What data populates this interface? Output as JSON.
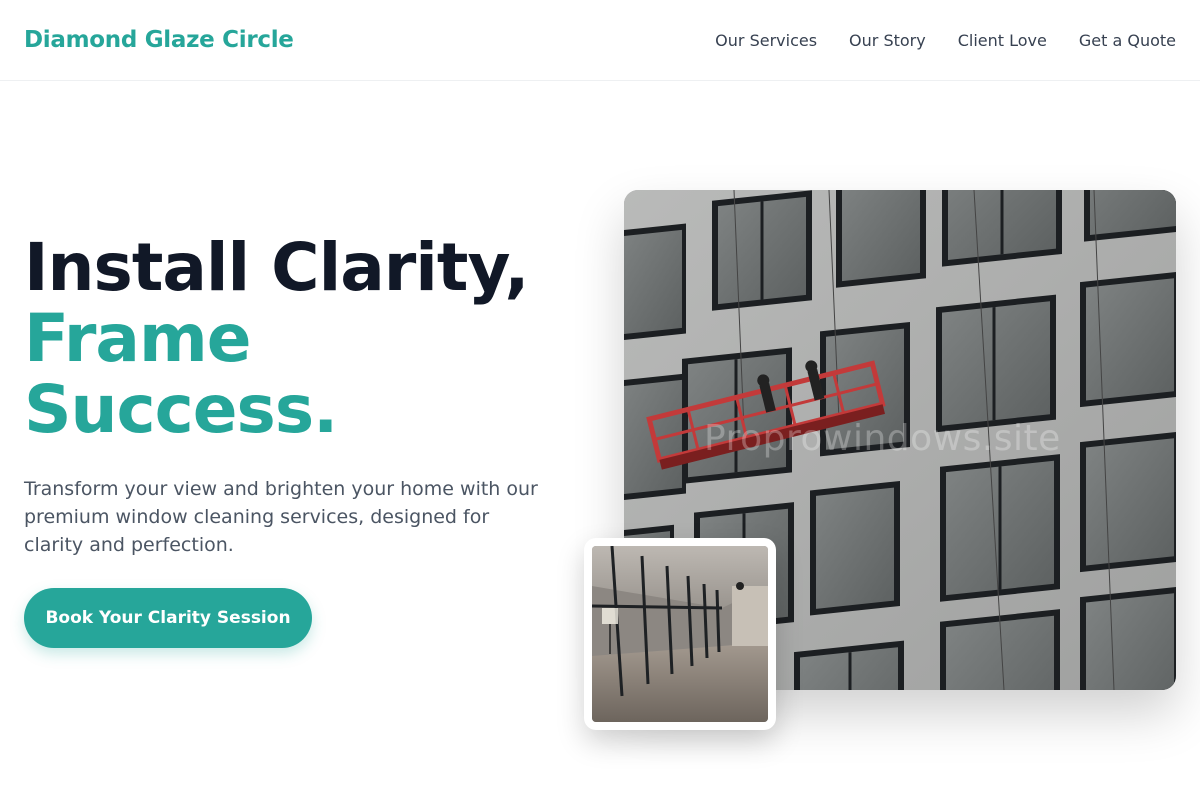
{
  "brand": {
    "name": "Diamond Glaze Circle",
    "accent": "#26a69a"
  },
  "nav": {
    "items": [
      {
        "label": "Our Services"
      },
      {
        "label": "Our Story"
      },
      {
        "label": "Client Love"
      },
      {
        "label": "Get a Quote"
      }
    ]
  },
  "hero": {
    "headline_line1": "Install Clarity,",
    "headline_line2": "Frame",
    "headline_line3": "Success.",
    "subtext": "Transform your view and brighten your home with our premium window cleaning services, designed for clarity and perfection.",
    "cta_label": "Book Your Clarity Session",
    "main_image": {
      "icon": "building-facade-window-cleaning-photo",
      "watermark": "Proprowindows.site"
    },
    "inset_image": {
      "icon": "interior-glass-hallway-photo"
    }
  }
}
